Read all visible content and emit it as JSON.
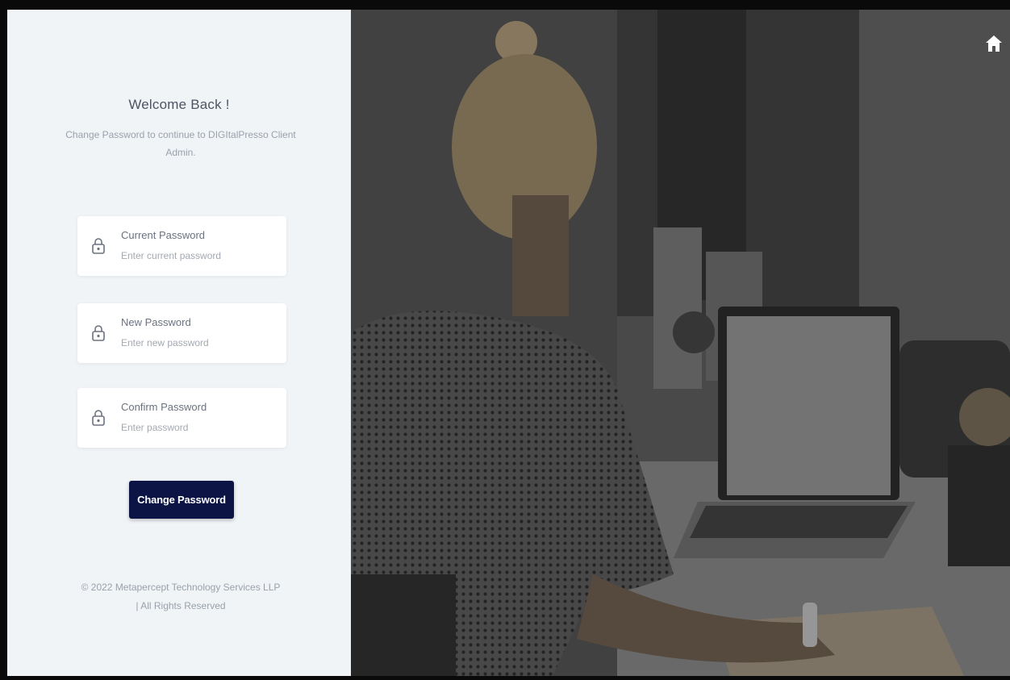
{
  "welcome": {
    "title": "Welcome Back !",
    "subtitle": "Change Password to continue to DIGItalPresso Client Admin."
  },
  "form": {
    "fields": [
      {
        "label": "Current Password",
        "placeholder": "Enter current password",
        "value": "",
        "icon": "lock-icon"
      },
      {
        "label": "New Password",
        "placeholder": "Enter new password",
        "value": "",
        "icon": "lock-icon"
      },
      {
        "label": "Confirm Password",
        "placeholder": "Enter password",
        "value": "",
        "icon": "lock-icon"
      }
    ],
    "submit_label": "Change Password"
  },
  "footer": {
    "copyright": "© 2022 Metapercept Technology Services LLP",
    "rights": "| All Rights Reserved"
  },
  "hero": {
    "home_icon": "home-icon"
  },
  "colors": {
    "button_bg": "#0c1446",
    "panel_bg": "#f1f4f7",
    "hero_overlay": "#3f3f3f"
  }
}
